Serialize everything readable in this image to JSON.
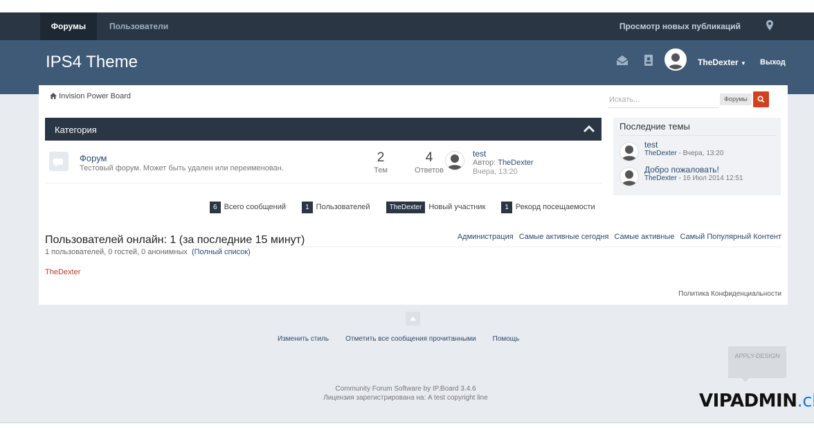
{
  "nav": {
    "tabs": [
      {
        "label": "Форумы",
        "active": true
      },
      {
        "label": "Пользователи",
        "active": false
      }
    ],
    "new_content_label": "Просмотр новых публикаций",
    "pin_icon": "map-marker-icon"
  },
  "header": {
    "logo": "IPS4 Theme",
    "icons": [
      "envelope-icon",
      "id-card-icon"
    ],
    "username": "TheDexter",
    "logout_label": "Выход"
  },
  "breadcrumb": {
    "home_icon": "home-icon",
    "label": "Invision Power Board"
  },
  "search": {
    "placeholder": "Искать...",
    "scope": "Форумы",
    "button_icon": "search-icon"
  },
  "category": {
    "title": "Категория",
    "collapse_icon": "chevron-up-icon",
    "forums": [
      {
        "title": "Форум",
        "description": "Тестовый форум. Может быть удален или переименован.",
        "topics": "2",
        "topics_label": "Тем",
        "replies": "4",
        "replies_label": "Ответов",
        "last_post": {
          "title": "test",
          "author_prefix": "Автор:",
          "author": "TheDexter",
          "date": "Вчера, 13:20"
        }
      }
    ]
  },
  "recent_topics": {
    "title": "Последние темы",
    "items": [
      {
        "title": "test",
        "author": "TheDexter",
        "date": " - Вчера, 13:20"
      },
      {
        "title": "Добро пожаловать!",
        "author": "TheDexter",
        "date": " - 16 Июл 2014 12:51"
      }
    ]
  },
  "board_stats": [
    {
      "badge": "6",
      "label": "Всего сообщений"
    },
    {
      "badge": "1",
      "label": "Пользователей"
    },
    {
      "badge": "TheDexter",
      "label": "Новый участник"
    },
    {
      "badge": "1",
      "label": "Рекорд посещаемости"
    }
  ],
  "online": {
    "title": "Пользователей онлайн: 1 (за последние 15 минут)",
    "links": [
      "Администрация",
      "Самые активные сегодня",
      "Самые активные",
      "Самый Популярный Контент"
    ],
    "summary": "1 пользователей, 0 гостей, 0 анонимных",
    "full_list": "(Полный список)",
    "users": [
      "TheDexter"
    ]
  },
  "privacy_label": "Политика Конфиденциальности",
  "footer": {
    "links": [
      "Изменить стиль",
      "Отметить все сообщения прочитанными",
      "Помощь"
    ],
    "apply_design": "APPLY-DESIGN",
    "copyright_line1": "Community Forum Software by IP.Board 3.4.6",
    "copyright_line2": "Лицензия зарегистрирована на: A test copyright line"
  },
  "watermark": {
    "main": "VIPADMIN",
    "suffix": ".club"
  },
  "colors": {
    "nav_bg": "#2a3644",
    "header_bg": "#3f5a76",
    "page_bg": "#e8ebef",
    "link": "#2b4a6b",
    "search_button": "#d0421e",
    "online_user": "#c0392b"
  }
}
